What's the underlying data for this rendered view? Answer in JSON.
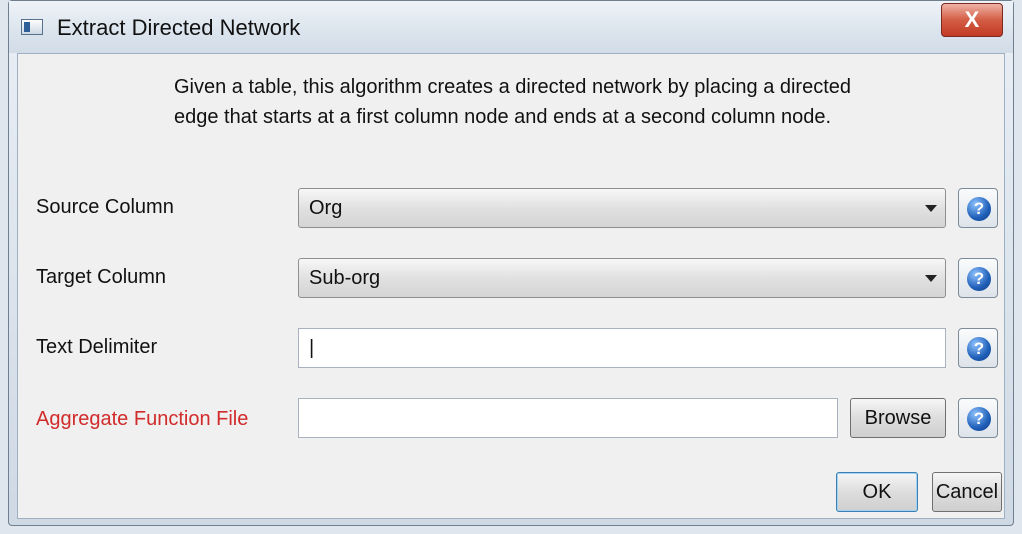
{
  "window": {
    "title": "Extract Directed Network",
    "close_label": "X"
  },
  "description": "Given a table, this algorithm creates a directed network by placing a directed edge that starts at a first column node and ends at a second column node.",
  "fields": {
    "source": {
      "label": "Source Column",
      "value": "Org"
    },
    "target": {
      "label": "Target Column",
      "value": "Sub-org"
    },
    "delimiter": {
      "label": "Text Delimiter",
      "value": "|"
    },
    "aggregate": {
      "label": "Aggregate Function File",
      "value": ""
    }
  },
  "buttons": {
    "browse": "Browse",
    "ok": "OK",
    "cancel": "Cancel",
    "help": "?"
  },
  "colors": {
    "required_label": "#d12b2b",
    "help_icon": "#1f5fb8"
  }
}
